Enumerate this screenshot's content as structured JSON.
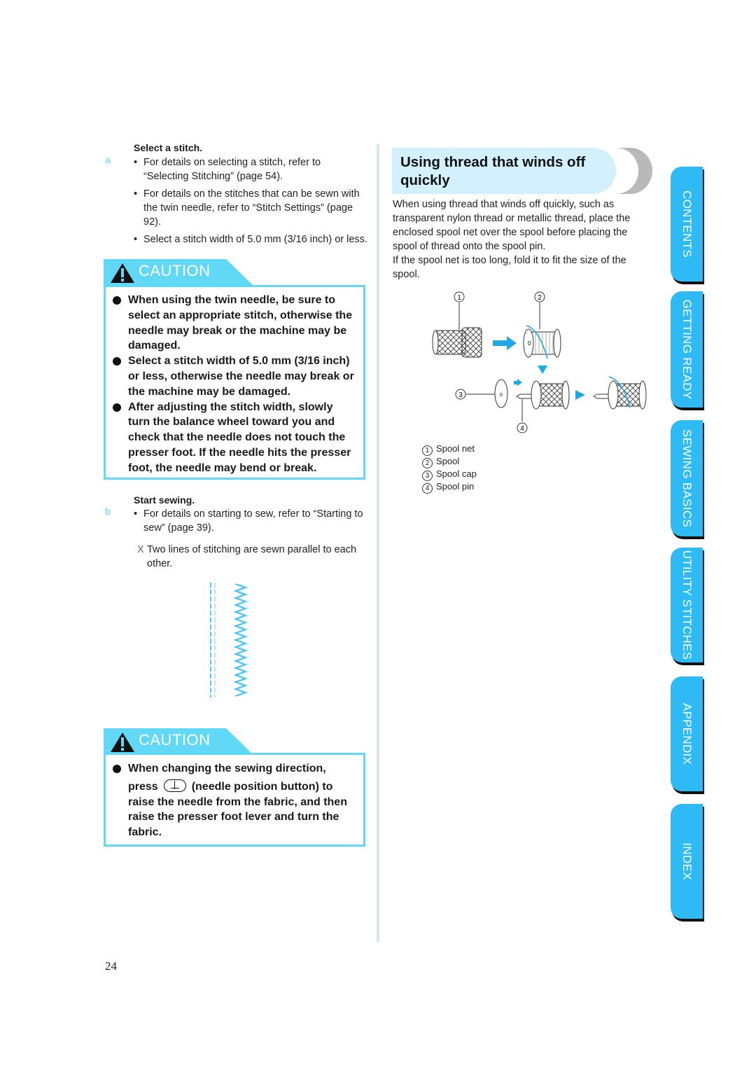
{
  "page_number": "24",
  "left_column": {
    "step_a": {
      "marker": "a",
      "title": "Select a stitch.",
      "bullets": [
        "For details on selecting a stitch, refer to “Selecting Stitching” (page 54).",
        "For details on the stitches that can be sewn with the twin needle, refer to “Stitch Settings” (page 92).",
        "Select a stitch width of 5.0 mm (3/16 inch) or less."
      ]
    },
    "caution_1": {
      "label": "CAUTION",
      "items": [
        "When using the twin needle, be sure to select an appropriate stitch, otherwise the needle may break or the machine may be damaged.",
        "Select a stitch width of 5.0 mm (3/16 inch) or less, otherwise the needle may break or the machine may be damaged.",
        "After adjusting the stitch width, slowly turn the balance wheel toward you and check that the needle does not touch the presser foot. If the needle hits the presser foot, the needle may bend or break."
      ]
    },
    "step_b": {
      "marker": "b",
      "title": "Start sewing.",
      "bullets": [
        "For details on starting to sew, refer to “Starting to sew” (page 39)."
      ],
      "result_marker": "X",
      "result": "Two lines of stitching are sewn parallel to each other."
    },
    "stitch_illustration": "twin-needle-stitch-sample",
    "caution_2": {
      "label": "CAUTION",
      "line1": "When changing the sewing direction,",
      "line2_pre": "press",
      "button_icon": "needle-position-button-icon",
      "line2_post": "(needle position button) to",
      "line3": "raise the needle from the fabric, and then raise the presser foot lever and turn the fabric."
    }
  },
  "right_column": {
    "heading": "Using thread that winds off quickly",
    "intro_p1": "When using thread that winds off quickly, such as transparent nylon thread or metallic thread, place the enclosed spool net over the spool before placing the spool of thread onto the spool pin.",
    "intro_p2": "If the spool net is too long, fold it to fit the size of the spool.",
    "figure": {
      "callouts": [
        "①",
        "②",
        "③",
        "④"
      ],
      "legend": [
        {
          "num": "1",
          "label": "Spool net"
        },
        {
          "num": "2",
          "label": "Spool"
        },
        {
          "num": "3",
          "label": "Spool cap"
        },
        {
          "num": "4",
          "label": "Spool pin"
        }
      ]
    }
  },
  "side_tabs": [
    {
      "label": "CONTENTS"
    },
    {
      "label": "GETTING READY"
    },
    {
      "label": "SEWING BASICS"
    },
    {
      "label": "UTILITY STITCHES"
    },
    {
      "label": "APPENDIX"
    },
    {
      "label": "INDEX"
    }
  ],
  "colors": {
    "accent": "#62d8f7",
    "tab_blue": "#2ebbf5",
    "heading_band": "#d2f1fc",
    "thread_blue": "#1fa8e8"
  }
}
